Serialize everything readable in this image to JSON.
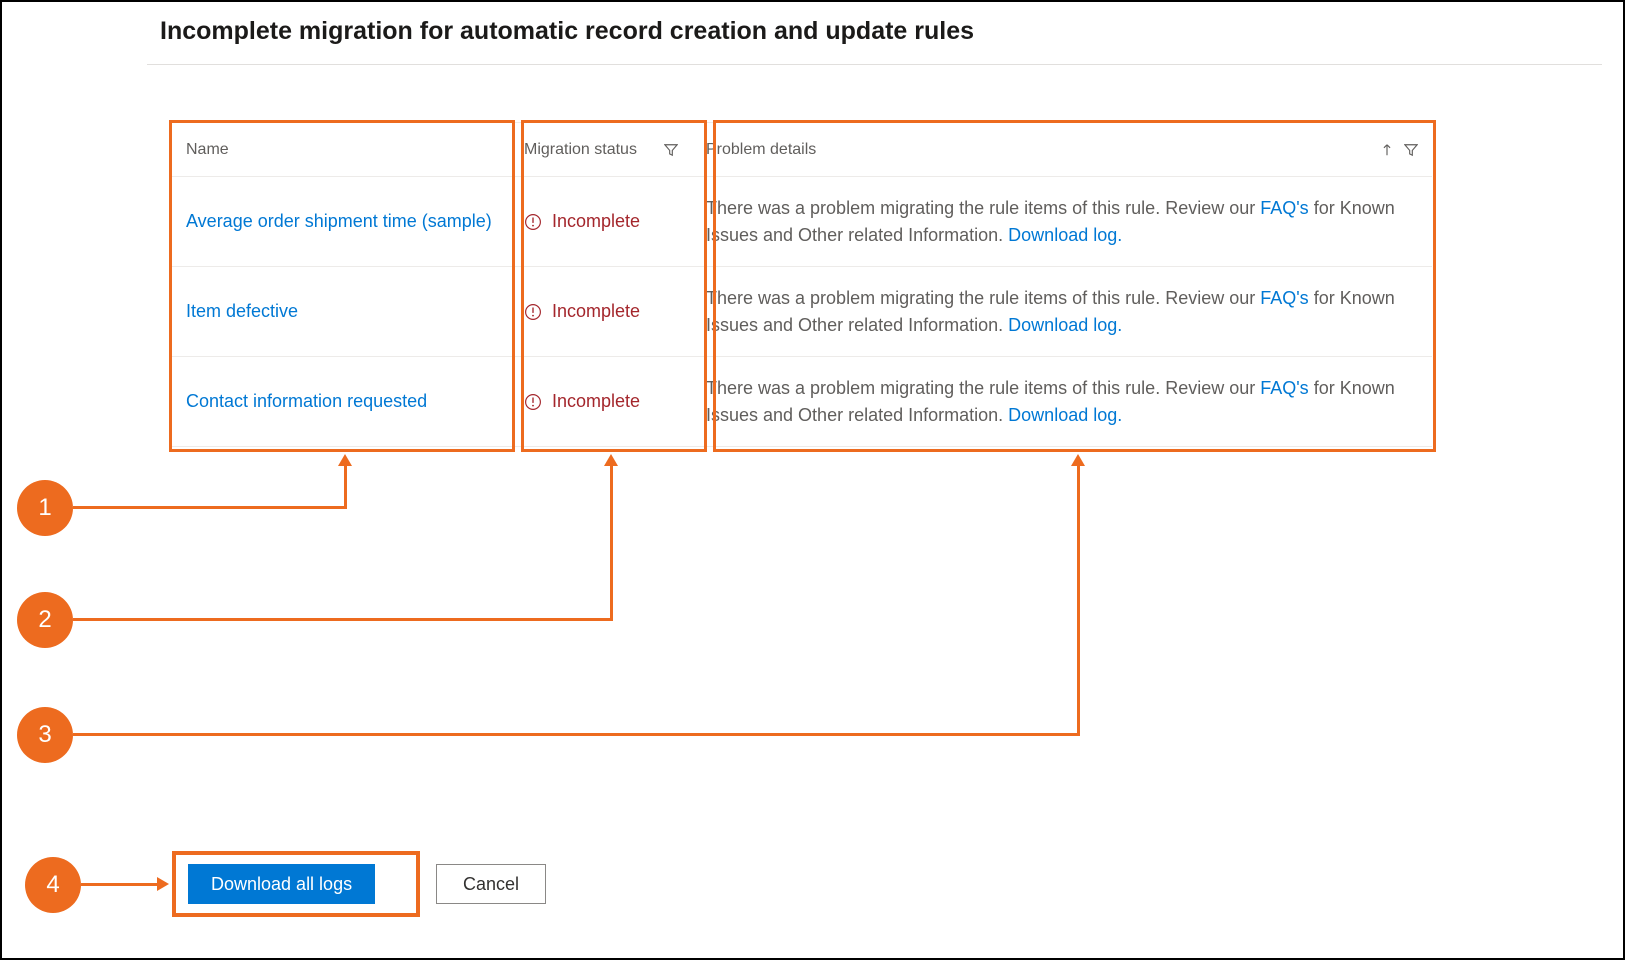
{
  "page_title": "Incomplete migration for automatic record creation and update rules",
  "columns": {
    "name": "Name",
    "status": "Migration status",
    "problem": "Problem details"
  },
  "problem_template": {
    "prefix": "There was a problem migrating the rule items of this rule. Review our ",
    "faq_link": "FAQ's",
    "middle": " for Known Issues and Other related Information. ",
    "download_link": "Download log."
  },
  "status_label": "Incomplete",
  "rows": [
    {
      "name": "Average order shipment time (sample)"
    },
    {
      "name": "Item defective"
    },
    {
      "name": "Contact information requested"
    }
  ],
  "callouts": {
    "1": "1",
    "2": "2",
    "3": "3",
    "4": "4"
  },
  "buttons": {
    "download_all": "Download all logs",
    "cancel": "Cancel"
  }
}
